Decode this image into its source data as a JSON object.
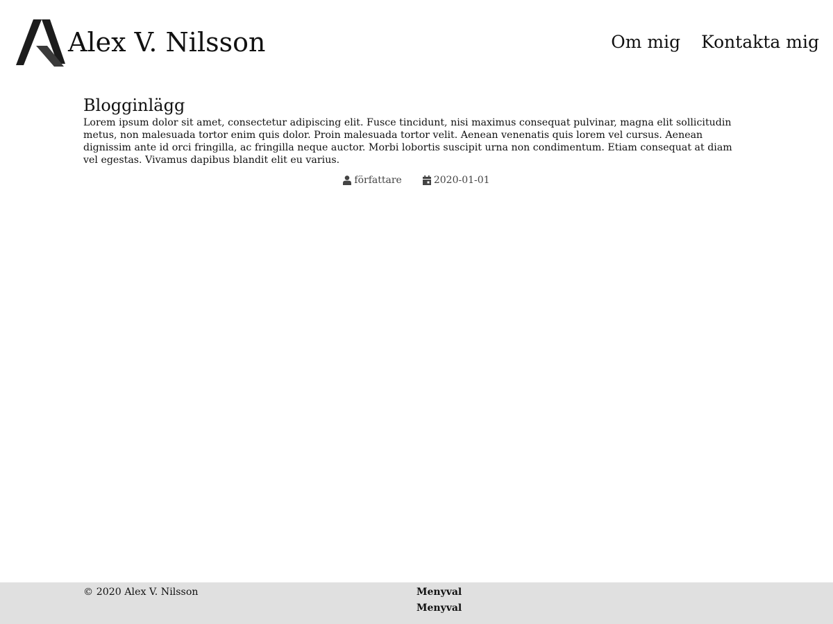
{
  "header": {
    "site_title": "Alex V. Nilsson",
    "logo_icon": "stylized-letter-a-logo",
    "nav": [
      {
        "label": "Om mig"
      },
      {
        "label": "Kontakta mig"
      }
    ]
  },
  "post": {
    "title": "Blogginlägg",
    "body": "Lorem ipsum dolor sit amet, consectetur adipiscing elit. Fusce tincidunt, nisi maximus consequat pulvinar, magna elit sollicitudin metus, non malesuada tortor enim quis dolor. Proin malesuada tortor velit. Aenean venenatis quis lorem vel cursus. Aenean dignissim ante id orci fringilla, ac fringilla neque auctor. Morbi lobortis suscipit urna non condimentum. Etiam consequat at diam vel egestas. Vivamus dapibus blandit elit eu varius.",
    "author_icon": "user-icon",
    "author": "författare",
    "date_icon": "calendar-icon",
    "date": "2020-01-01"
  },
  "footer": {
    "copyright": "© 2020 Alex V. Nilsson",
    "menu": [
      {
        "label": "Menyval"
      },
      {
        "label": "Menyval"
      }
    ],
    "background_color": "#e0e0e0"
  }
}
